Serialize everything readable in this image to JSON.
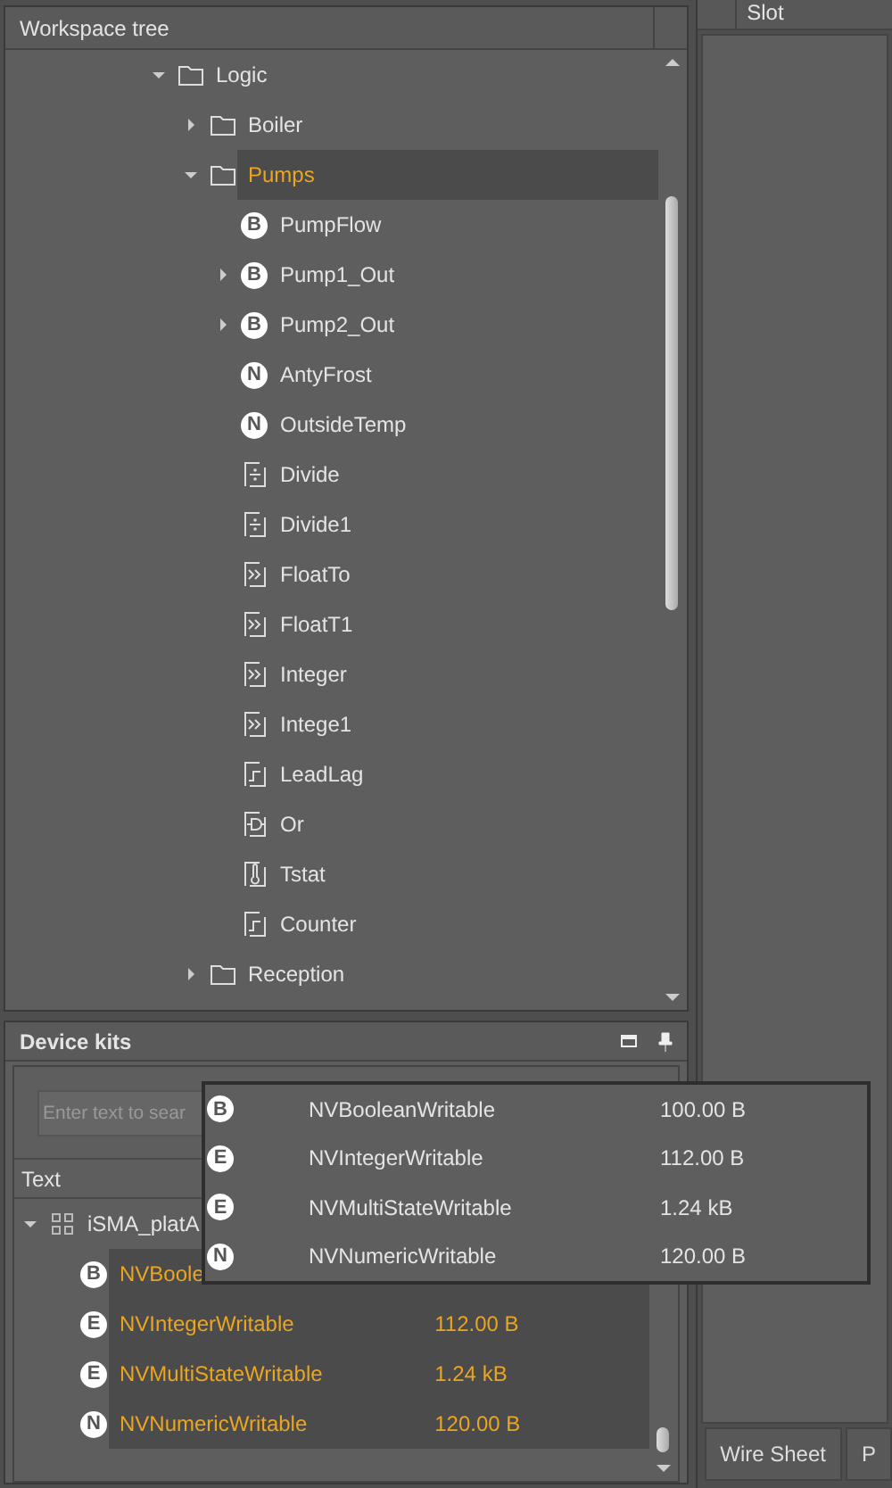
{
  "workspace_tree": {
    "title": "Workspace tree",
    "nodes": [
      {
        "label": "Logic",
        "kind": "folder",
        "expanded": true,
        "selected": false,
        "children": [
          {
            "label": "Boiler",
            "kind": "folder",
            "expanded": false,
            "selected": false
          },
          {
            "label": "Pumps",
            "kind": "folder",
            "expanded": true,
            "selected": true,
            "children": [
              {
                "label": "PumpFlow",
                "kind": "badge",
                "badge": "B",
                "selected": false
              },
              {
                "label": "Pump1_Out",
                "kind": "badge",
                "badge": "B",
                "expanded": false,
                "selected": false
              },
              {
                "label": "Pump2_Out",
                "kind": "badge",
                "badge": "B",
                "expanded": false,
                "selected": false
              },
              {
                "label": "AntyFrost",
                "kind": "badge",
                "badge": "N",
                "selected": false
              },
              {
                "label": "OutsideTemp",
                "kind": "badge",
                "badge": "N",
                "selected": false
              },
              {
                "label": "Divide",
                "kind": "divide",
                "selected": false
              },
              {
                "label": "Divide1",
                "kind": "divide",
                "selected": false
              },
              {
                "label": "FloatTo",
                "kind": "converter",
                "selected": false
              },
              {
                "label": "FloatT1",
                "kind": "converter",
                "selected": false
              },
              {
                "label": "Integer",
                "kind": "converter",
                "selected": false
              },
              {
                "label": "Intege1",
                "kind": "converter",
                "selected": false
              },
              {
                "label": "LeadLag",
                "kind": "step",
                "selected": false
              },
              {
                "label": "Or",
                "kind": "gate",
                "selected": false
              },
              {
                "label": "Tstat",
                "kind": "thermometer",
                "selected": false
              },
              {
                "label": "Counter",
                "kind": "step",
                "selected": false
              }
            ]
          },
          {
            "label": "Reception",
            "kind": "folder",
            "expanded": false,
            "selected": false
          }
        ]
      }
    ]
  },
  "slot_panel": {
    "column": "Slot",
    "tabs": [
      {
        "label": "Wire Sheet"
      },
      {
        "label": "P"
      }
    ]
  },
  "device_kits": {
    "title": "Device kits",
    "search": {
      "placeholder": "Enter text to sear"
    },
    "column": "Text",
    "nodes": [
      {
        "label": "iSMA_platA",
        "kind": "grid",
        "expanded": true,
        "selected": false,
        "children": [
          {
            "label": "NVBoole",
            "kind": "badge",
            "badge": "B",
            "selected": true
          },
          {
            "label": "NVIntegerWritable",
            "kind": "badge",
            "badge": "E",
            "size": "112.00 B",
            "selected": true
          },
          {
            "label": "NVMultiStateWritable",
            "kind": "badge",
            "badge": "E",
            "size": "1.24 kB",
            "selected": true
          },
          {
            "label": "NVNumericWritable",
            "kind": "badge",
            "badge": "N",
            "size": "120.00 B",
            "selected": true
          }
        ]
      }
    ]
  },
  "drag_preview": {
    "rows": [
      {
        "badge": "B",
        "name": "NVBooleanWritable",
        "size": "100.00 B"
      },
      {
        "badge": "E",
        "name": "NVIntegerWritable",
        "size": "112.00 B"
      },
      {
        "badge": "E",
        "name": "NVMultiStateWritable",
        "size": "1.24 kB"
      },
      {
        "badge": "N",
        "name": "NVNumericWritable",
        "size": "120.00 B"
      }
    ]
  }
}
